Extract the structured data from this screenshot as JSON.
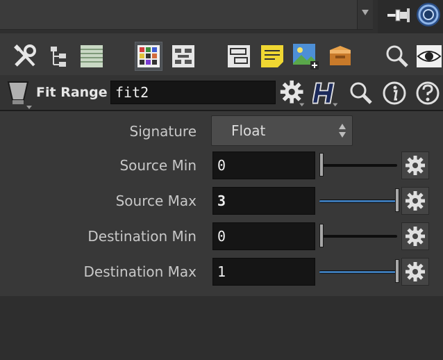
{
  "node": {
    "type_label": "Fit Range",
    "name": "fit2"
  },
  "toolbar_icons": [
    "wrench-icon",
    "hierarchy-icon",
    "list-icon",
    "color-grid-icon",
    "layout-icon",
    "node-view-icon",
    "sticky-note-icon",
    "add-image-icon",
    "box-icon",
    "search-icon",
    "eye-icon"
  ],
  "nodebar_icons": [
    "gear-icon",
    "help-h-icon",
    "search-icon",
    "info-icon",
    "help-question-icon"
  ],
  "params": {
    "signature": {
      "label": "Signature",
      "value": "Float"
    },
    "source_min": {
      "label": "Source Min",
      "value": "0",
      "slider_fraction": 0.0
    },
    "source_max": {
      "label": "Source Max",
      "value": "3",
      "slider_fraction": 1.0
    },
    "destination_min": {
      "label": "Destination Min",
      "value": "0",
      "slider_fraction": 0.0
    },
    "destination_max": {
      "label": "Destination Max",
      "value": "1",
      "slider_fraction": 1.0
    }
  },
  "colors": {
    "background": "#3a3a3a",
    "field": "#151515",
    "slider_active": "#3c78b4"
  }
}
